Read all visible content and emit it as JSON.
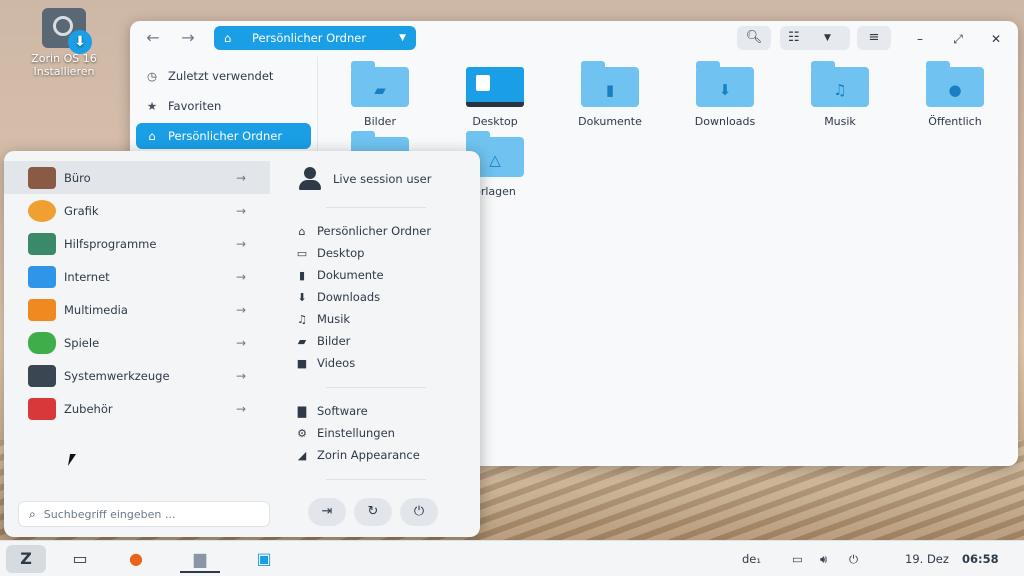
{
  "desktop": {
    "icon_label_line1": "Zorin OS 16",
    "icon_label_line2": "Installieren"
  },
  "file_manager": {
    "path_label": "Persönlicher Ordner",
    "sidebar": [
      {
        "label": "Zuletzt verwendet",
        "icon": "clock-icon"
      },
      {
        "label": "Favoriten",
        "icon": "star-icon"
      },
      {
        "label": "Persönlicher Ordner",
        "icon": "home-icon",
        "active": true
      }
    ],
    "files": [
      {
        "label": "Bilder",
        "icon": "pictures-folder-icon"
      },
      {
        "label": "Desktop",
        "icon": "desktop-folder-icon"
      },
      {
        "label": "Dokumente",
        "icon": "documents-folder-icon"
      },
      {
        "label": "Downloads",
        "icon": "downloads-folder-icon"
      },
      {
        "label": "Musik",
        "icon": "music-folder-icon"
      },
      {
        "label": "Öffentlich",
        "icon": "public-folder-icon"
      },
      {
        "label": "",
        "icon": "videos-folder-icon"
      },
      {
        "label": "orlagen",
        "icon": "templates-folder-icon"
      }
    ]
  },
  "menu": {
    "categories": [
      {
        "label": "Büro",
        "icon": "office-icon",
        "color": "#8a5a44"
      },
      {
        "label": "Grafik",
        "icon": "graphics-icon",
        "color": "#f0a030"
      },
      {
        "label": "Hilfsprogramme",
        "icon": "utilities-icon",
        "color": "#3a8a6a"
      },
      {
        "label": "Internet",
        "icon": "internet-icon",
        "color": "#2e95e8"
      },
      {
        "label": "Multimedia",
        "icon": "multimedia-icon",
        "color": "#f08a20"
      },
      {
        "label": "Spiele",
        "icon": "games-icon",
        "color": "#3fae4a"
      },
      {
        "label": "Systemwerkzeuge",
        "icon": "system-tools-icon",
        "color": "#3a4652"
      },
      {
        "label": "Zubehör",
        "icon": "accessories-icon",
        "color": "#d8383a"
      }
    ],
    "user_name": "Live session user",
    "places": [
      {
        "label": "Persönlicher Ordner",
        "icon": "home-icon"
      },
      {
        "label": "Desktop",
        "icon": "desktop-icon"
      },
      {
        "label": "Dokumente",
        "icon": "document-icon"
      },
      {
        "label": "Downloads",
        "icon": "download-icon"
      },
      {
        "label": "Musik",
        "icon": "music-icon"
      },
      {
        "label": "Bilder",
        "icon": "picture-icon"
      },
      {
        "label": "Videos",
        "icon": "video-icon"
      }
    ],
    "system": [
      {
        "label": "Software",
        "icon": "software-icon"
      },
      {
        "label": "Einstellungen",
        "icon": "settings-icon"
      },
      {
        "label": "Zorin Appearance",
        "icon": "appearance-icon"
      }
    ],
    "search_placeholder": "Suchbegriff eingeben ..."
  },
  "taskbar": {
    "keyboard_layout": "de₁",
    "date": "19. Dez",
    "time": "06:58"
  },
  "colors": {
    "accent": "#1a9fe6",
    "folder": "#70c3f0"
  }
}
